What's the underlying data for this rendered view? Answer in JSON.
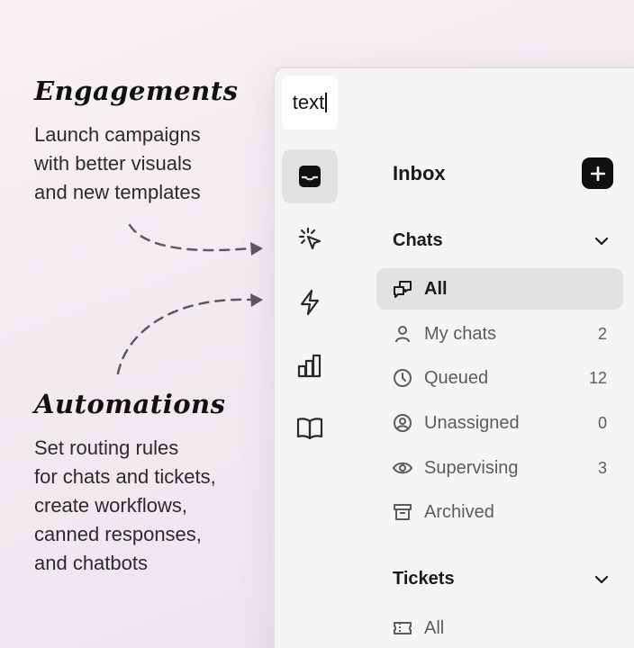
{
  "annotations": {
    "engagements": {
      "title": "Engagements",
      "text": "Launch campaigns\nwith better visuals\nand new templates"
    },
    "automations": {
      "title": "Automations",
      "text": "Set routing rules\nfor chats and tickets,\ncreate workflows,\ncanned responses,\nand chatbots"
    }
  },
  "app": {
    "logo_text": "text",
    "rail": [
      {
        "icon": "inbox-icon",
        "active": true
      },
      {
        "icon": "sparkle-cursor-icon",
        "active": false
      },
      {
        "icon": "lightning-icon",
        "active": false
      },
      {
        "icon": "bar-chart-icon",
        "active": false
      },
      {
        "icon": "book-icon",
        "active": false
      }
    ],
    "inbox": {
      "title": "Inbox",
      "add_icon": "plus-icon",
      "chats": {
        "label": "Chats",
        "items": [
          {
            "label": "All",
            "count": "",
            "icon": "chat-bubbles-icon",
            "active": true
          },
          {
            "label": "My chats",
            "count": "2",
            "icon": "person-icon",
            "active": false
          },
          {
            "label": "Queued",
            "count": "12",
            "icon": "clock-icon",
            "active": false
          },
          {
            "label": "Unassigned",
            "count": "0",
            "icon": "user-circle-icon",
            "active": false
          },
          {
            "label": "Supervising",
            "count": "3",
            "icon": "eye-icon",
            "active": false
          },
          {
            "label": "Archived",
            "count": "",
            "icon": "archive-icon",
            "active": false
          }
        ]
      },
      "tickets": {
        "label": "Tickets",
        "items": [
          {
            "label": "All",
            "count": "",
            "icon": "ticket-icon",
            "active": false
          }
        ]
      }
    }
  }
}
